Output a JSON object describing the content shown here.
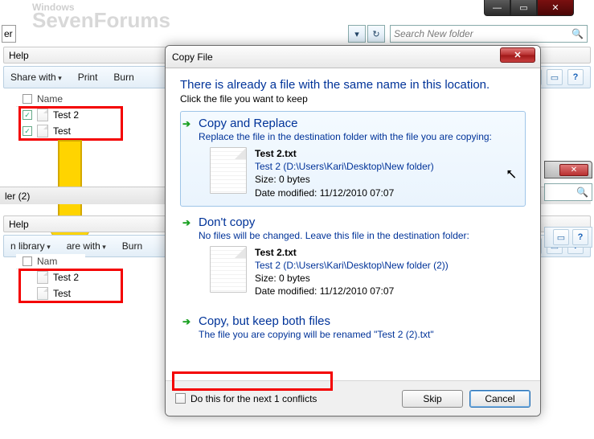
{
  "backdrop": {
    "small": "Windows",
    "big": "SevenForums"
  },
  "addr_fragment": "er",
  "search_placeholder": "Search New folder",
  "win1": {
    "menu": {
      "help": "Help"
    },
    "cmd": {
      "share": "Share with",
      "print": "Print",
      "burn": "Burn"
    },
    "header": "Name",
    "files": [
      {
        "name": "Test 2",
        "checked": true
      },
      {
        "name": "Test",
        "checked": true
      }
    ]
  },
  "status": {
    "text": "ler (2)"
  },
  "win2": {
    "menu": {
      "help": "Help"
    },
    "cmd": {
      "library": "n library",
      "share": "are with",
      "burn": "Burn"
    },
    "header": "Nam",
    "files": [
      {
        "name": "Test 2"
      },
      {
        "name": "Test"
      }
    ]
  },
  "dialog": {
    "title": "Copy File",
    "heading": "There is already a file with the same name in this location.",
    "subheading": "Click the file you want to keep",
    "options": [
      {
        "title": "Copy and Replace",
        "desc": "Replace the file in the destination folder with the file you are copying:",
        "file": {
          "name": "Test 2.txt",
          "path": "Test 2 (D:\\Users\\Kari\\Desktop\\New folder)",
          "size": "Size: 0 bytes",
          "modified": "Date modified: 11/12/2010 07:07"
        }
      },
      {
        "title": "Don't copy",
        "desc": "No files will be changed. Leave this file in the destination folder:",
        "file": {
          "name": "Test 2.txt",
          "path": "Test 2 (D:\\Users\\Kari\\Desktop\\New folder (2))",
          "size": "Size: 0 bytes",
          "modified": "Date modified: 11/12/2010 07:07"
        }
      },
      {
        "title": "Copy, but keep both files",
        "desc": "The file you are copying will be renamed \"Test 2 (2).txt\""
      }
    ],
    "footer_check": "Do this for the next 1 conflicts",
    "skip": "Skip",
    "cancel": "Cancel"
  }
}
